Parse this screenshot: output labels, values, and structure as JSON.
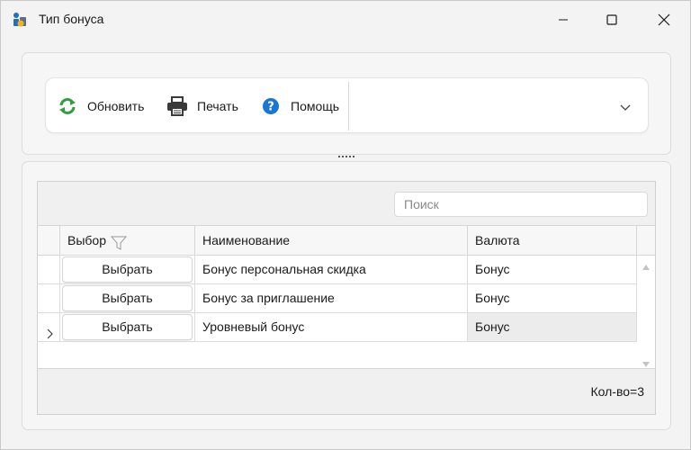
{
  "window": {
    "title": "Тип бонуса"
  },
  "toolbar": {
    "refresh_label": "Обновить",
    "print_label": "Печать",
    "help_label": "Помощь"
  },
  "grid": {
    "search_placeholder": "Поиск",
    "columns": {
      "select": "Выбор",
      "name": "Наименование",
      "currency": "Валюта"
    },
    "rows": [
      {
        "button": "Выбрать",
        "name": "Бонус персональная скидка",
        "currency": "Бонус"
      },
      {
        "button": "Выбрать",
        "name": "Бонус за приглашение",
        "currency": "Бонус"
      },
      {
        "button": "Выбрать",
        "name": "Уровневый бонус",
        "currency": "Бонус"
      }
    ],
    "current_row_index": 2,
    "footer_count": "Кол-во=3"
  },
  "colors": {
    "refresh_green": "#2e9e3e",
    "help_blue": "#1976d2",
    "printer_dark": "#3a3a3a",
    "window_bg": "#f3f3f3"
  },
  "icons": {
    "app": "bonus-type-app-icon",
    "refresh": "refresh-icon",
    "print": "printer-icon",
    "help": "help-icon",
    "filter": "filter-icon",
    "chevron": "chevron-down-icon",
    "row_indicator": "current-row-arrow-icon"
  }
}
